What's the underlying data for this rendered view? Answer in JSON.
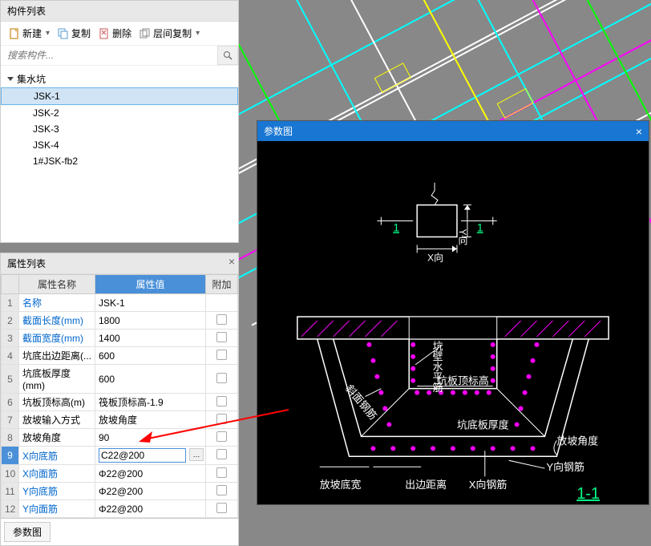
{
  "component_panel": {
    "title": "构件列表",
    "toolbar": {
      "new": "新建",
      "copy": "复制",
      "delete": "删除",
      "layer_copy": "层间复制"
    },
    "search_placeholder": "搜索构件...",
    "root": "集水坑",
    "items": [
      "JSK-1",
      "JSK-2",
      "JSK-3",
      "JSK-4",
      "1#JSK-fb2"
    ],
    "selected_index": 0
  },
  "property_panel": {
    "title": "属性列表",
    "headers": {
      "name": "属性名称",
      "value": "属性值",
      "extra": "附加"
    },
    "rows": [
      {
        "n": "1",
        "name": "名称",
        "value": "JSK-1",
        "blue": true,
        "checkbox": false
      },
      {
        "n": "2",
        "name": "截面长度(mm)",
        "value": "1800",
        "blue": true,
        "checkbox": true
      },
      {
        "n": "3",
        "name": "截面宽度(mm)",
        "value": "1400",
        "blue": true,
        "checkbox": true
      },
      {
        "n": "4",
        "name": "坑底出边距离(...",
        "value": "600",
        "blue": false,
        "checkbox": true
      },
      {
        "n": "5",
        "name": "坑底板厚度(mm)",
        "value": "600",
        "blue": false,
        "checkbox": true
      },
      {
        "n": "6",
        "name": "坑板顶标高(m)",
        "value": "筏板顶标高-1.9",
        "blue": false,
        "checkbox": true
      },
      {
        "n": "7",
        "name": "放坡输入方式",
        "value": "放坡角度",
        "blue": false,
        "checkbox": true
      },
      {
        "n": "8",
        "name": "放坡角度",
        "value": "90",
        "blue": false,
        "checkbox": true
      },
      {
        "n": "9",
        "name": "X向底筋",
        "value": "C22@200",
        "blue": true,
        "checkbox": true,
        "editing": true
      },
      {
        "n": "10",
        "name": "X向面筋",
        "value": "Φ22@200",
        "blue": true,
        "checkbox": true
      },
      {
        "n": "11",
        "name": "Y向底筋",
        "value": "Φ22@200",
        "blue": true,
        "checkbox": true
      },
      {
        "n": "12",
        "name": "Y向面筋",
        "value": "Φ22@200",
        "blue": true,
        "checkbox": true
      }
    ],
    "param_btn": "参数图"
  },
  "param_window": {
    "title": "参数图",
    "labels": {
      "one": "1",
      "x_dir": "X向",
      "y_dir": "Y向",
      "wall_rebar": "坑壁水平筋",
      "top_elev": "坑板顶标高",
      "bottom_thick": "坑底板厚度",
      "slope_angle": "放坡角度",
      "y_rebar": "Y向钢筋",
      "x_rebar": "X向钢筋",
      "slope_width": "放坡底宽",
      "edge_dist": "出边距离",
      "section": "1-1",
      "slant_rebar": "斜面钢筋"
    }
  }
}
